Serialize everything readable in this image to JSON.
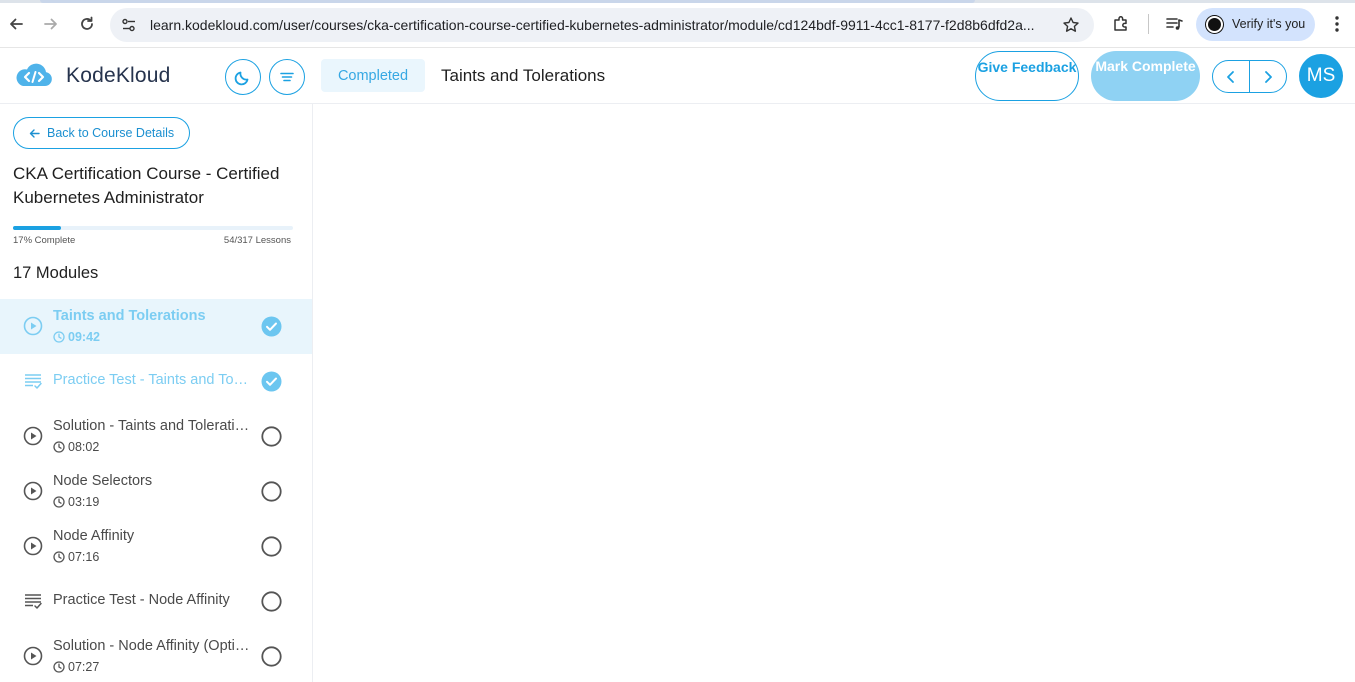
{
  "browser": {
    "url": "learn.kodekloud.com/user/courses/cka-certification-course-certified-kubernetes-administrator/module/cd124bdf-9911-4cc1-8177-f2d8b6dfd2a...",
    "verify_label": "Verify it's you"
  },
  "header": {
    "brand": "KodeKloud",
    "status": "Completed",
    "lesson_title": "Taints and Tolerations",
    "feedback_label": "Give Feedback",
    "mark_label": "Mark Complete",
    "avatar_initials": "MS",
    "accent_color": "#1ba1e2"
  },
  "sidebar": {
    "back_label": "Back to Course Details",
    "course_title": "CKA Certification Course - Certified Kubernetes Administrator",
    "progress_fraction": 0.17,
    "progress_text": "17% Complete",
    "lessons_text": "54/317 Lessons",
    "modules_text": "17 Modules",
    "lessons": [
      {
        "type": "video",
        "title": "Taints and Tolerations",
        "duration": "09:42",
        "completed": true,
        "active": true
      },
      {
        "type": "practice",
        "title": "Practice Test - Taints and Tolerations",
        "duration": "",
        "completed": true,
        "active": false
      },
      {
        "type": "video",
        "title": "Solution - Taints and Tolerations",
        "duration": "08:02",
        "completed": false,
        "active": false
      },
      {
        "type": "video",
        "title": "Node Selectors",
        "duration": "03:19",
        "completed": false,
        "active": false
      },
      {
        "type": "video",
        "title": "Node Affinity",
        "duration": "07:16",
        "completed": false,
        "active": false
      },
      {
        "type": "practice",
        "title": "Practice Test - Node Affinity",
        "duration": "",
        "completed": false,
        "active": false
      },
      {
        "type": "video",
        "title": "Solution - Node Affinity (Optional)",
        "duration": "07:27",
        "completed": false,
        "active": false
      }
    ]
  }
}
